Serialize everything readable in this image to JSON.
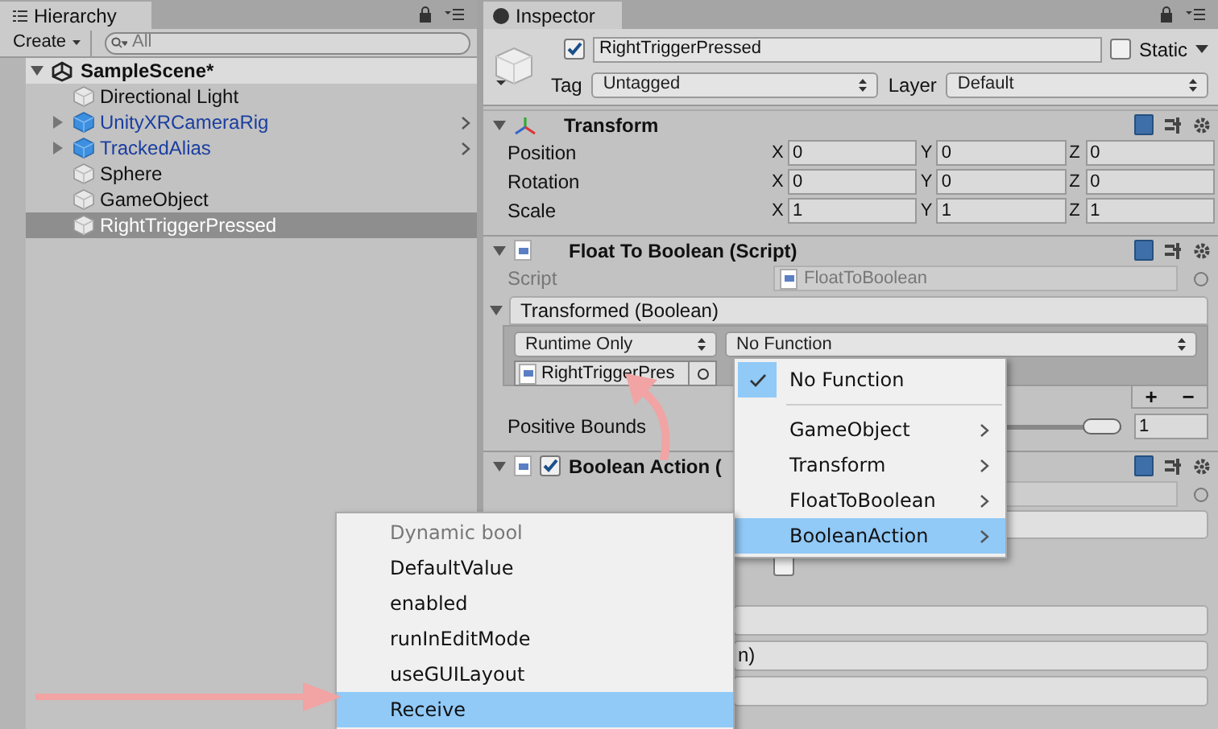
{
  "hierarchy": {
    "title": "Hierarchy",
    "create_button": "Create",
    "search": {
      "placeholder": "All"
    },
    "scene": {
      "name": "SampleScene*",
      "expanded": true
    },
    "objects": [
      {
        "name": "Directional Light",
        "kind": "object",
        "selected": false
      },
      {
        "name": "UnityXRCameraRig",
        "kind": "prefab",
        "selected": false
      },
      {
        "name": "TrackedAlias",
        "kind": "prefab",
        "selected": false
      },
      {
        "name": "Sphere",
        "kind": "object",
        "selected": false
      },
      {
        "name": "GameObject",
        "kind": "object",
        "selected": false
      },
      {
        "name": "RightTriggerPressed",
        "kind": "object",
        "selected": true
      }
    ]
  },
  "inspector": {
    "title": "Inspector",
    "object": {
      "active": true,
      "name": "RightTriggerPressed",
      "static": false,
      "static_label": "Static",
      "tag_label": "Tag",
      "tag": "Untagged",
      "layer_label": "Layer",
      "layer": "Default"
    },
    "transform": {
      "title": "Transform",
      "expanded": true,
      "rows": [
        {
          "label": "Position",
          "values": [
            {
              "axis": "X",
              "value": "0"
            },
            {
              "axis": "Y",
              "value": "0"
            },
            {
              "axis": "Z",
              "value": "0"
            }
          ]
        },
        {
          "label": "Rotation",
          "values": [
            {
              "axis": "X",
              "value": "0"
            },
            {
              "axis": "Y",
              "value": "0"
            },
            {
              "axis": "Z",
              "value": "0"
            }
          ]
        },
        {
          "label": "Scale",
          "values": [
            {
              "axis": "X",
              "value": "1"
            },
            {
              "axis": "Y",
              "value": "1"
            },
            {
              "axis": "Z",
              "value": "1"
            }
          ]
        }
      ]
    },
    "float_to_boolean": {
      "title": "Float To Boolean (Script)",
      "expanded": true,
      "script_label": "Script",
      "script": "FloatToBoolean",
      "event": {
        "title": "Transformed (Boolean)",
        "expanded": true,
        "mode": "Runtime Only",
        "function": "No Function",
        "target": "RightTriggerPres",
        "add": "+",
        "remove": "−"
      },
      "positive_bounds_label": "Positive Bounds",
      "positive_bounds": {
        "level": 1,
        "value": "1"
      }
    },
    "boolean_action": {
      "title": "Boolean Action (",
      "enabled": true,
      "checkbox": false,
      "field_text": "n)"
    }
  },
  "function_menu": {
    "items": [
      {
        "kind": "option",
        "label": "No Function",
        "selected": true
      },
      {
        "kind": "separator"
      },
      {
        "kind": "submenu",
        "label": "GameObject",
        "selected": false
      },
      {
        "kind": "submenu",
        "label": "Transform",
        "selected": false
      },
      {
        "kind": "submenu",
        "label": "FloatToBoolean",
        "selected": false
      },
      {
        "kind": "submenu",
        "label": "BooleanAction",
        "selected": true
      }
    ]
  },
  "submenu": {
    "header": "Dynamic bool",
    "items": [
      {
        "label": "DefaultValue",
        "selected": false
      },
      {
        "label": "enabled",
        "selected": false
      },
      {
        "label": "runInEditMode",
        "selected": false
      },
      {
        "label": "useGUILayout",
        "selected": false
      },
      {
        "label": "Receive",
        "selected": true
      }
    ]
  }
}
